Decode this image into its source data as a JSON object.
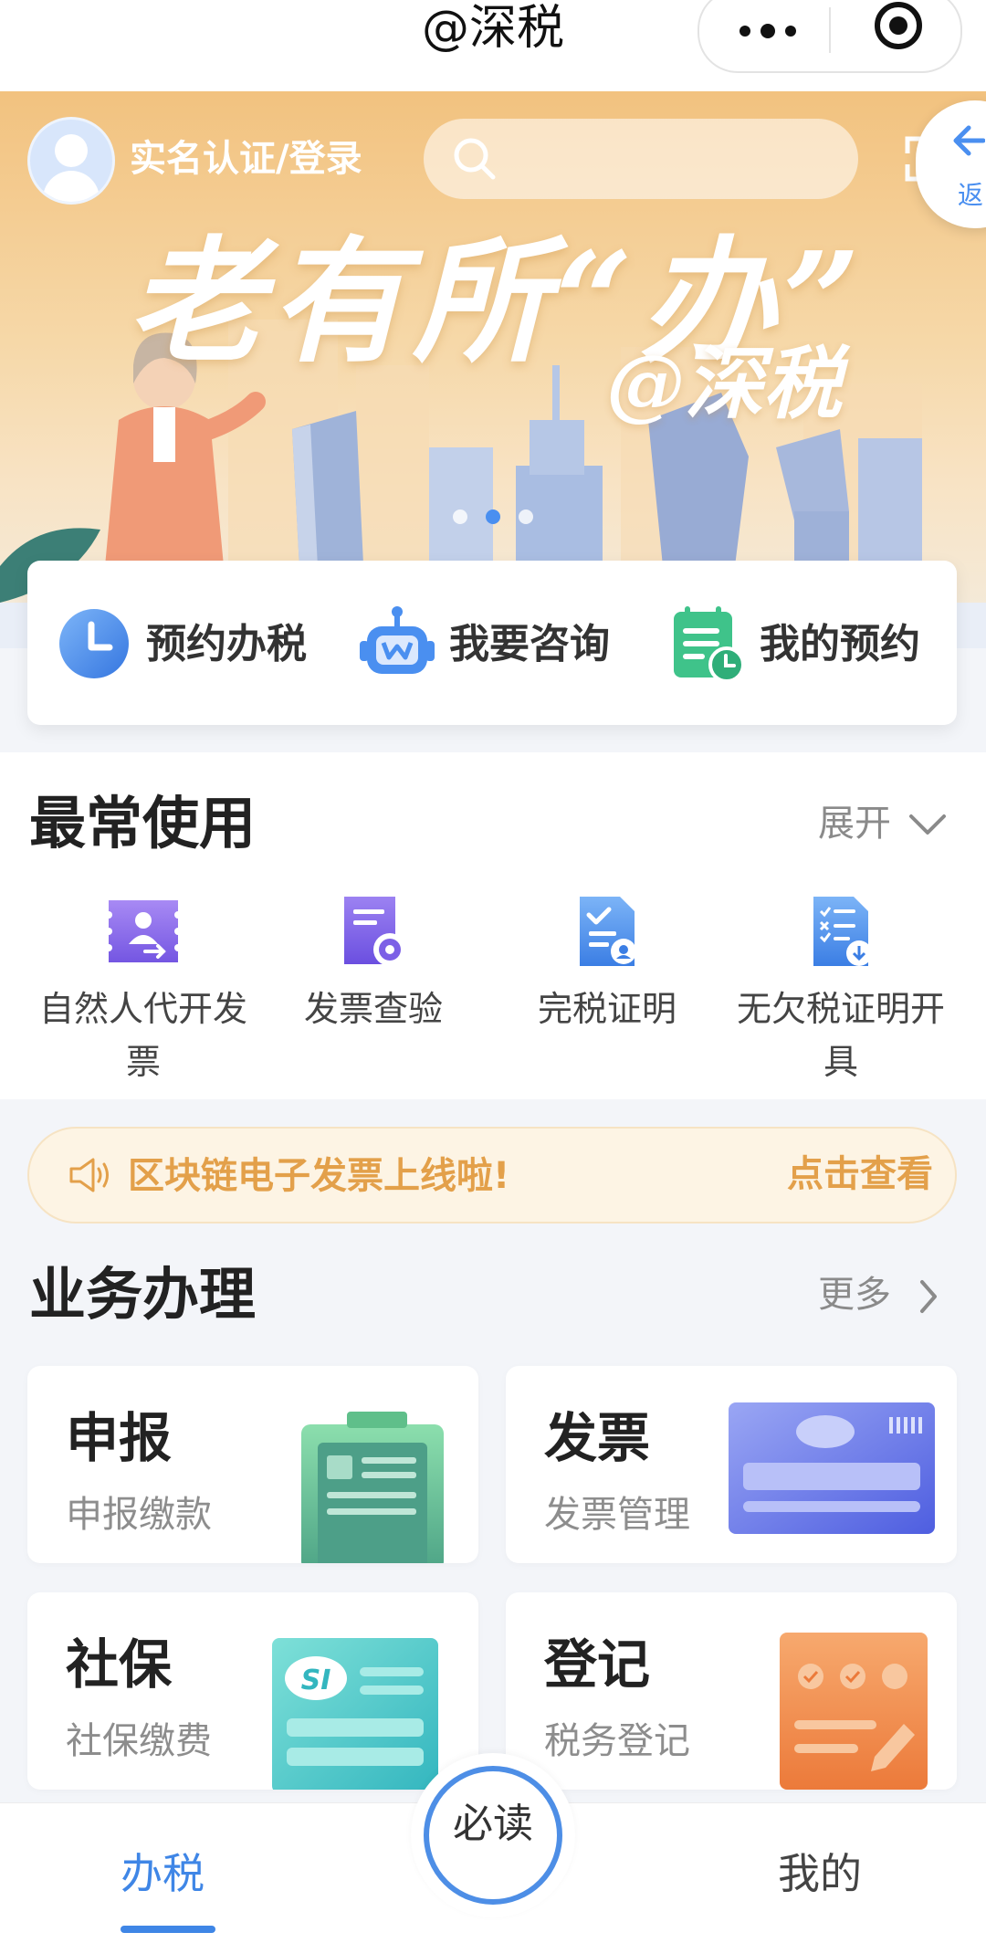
{
  "topbar": {
    "title": "@深税",
    "more_icon": "more-dots-icon",
    "close_icon": "target-close-icon"
  },
  "banner": {
    "login_label": "实名认证/登录",
    "search_placeholder": "",
    "back_label": "返",
    "slogan": "老有所“办”",
    "handle": "@深税",
    "dots": 3,
    "active_dot": 2
  },
  "quick_actions": [
    {
      "label": "预约办税",
      "icon": "clock-icon",
      "color": "#3f86e6"
    },
    {
      "label": "我要咨询",
      "icon": "robot-icon",
      "color": "#4a8ff0"
    },
    {
      "label": "我的预约",
      "icon": "calendar-list-icon",
      "color": "#3fc38a"
    }
  ],
  "most_used": {
    "title": "最常使用",
    "expand_label": "展开",
    "items": [
      {
        "label": "自然人代开发票",
        "icon": "invoice-person-icon"
      },
      {
        "label": "发票查验",
        "icon": "invoice-check-icon"
      },
      {
        "label": "完税证明",
        "icon": "tax-certificate-icon"
      },
      {
        "label": "无欠税证明开具",
        "icon": "no-arrears-certificate-icon"
      }
    ]
  },
  "notice": {
    "message": "区块链电子发票上线啦!",
    "link": "点击查看",
    "icon": "speaker-icon"
  },
  "business": {
    "title": "业务办理",
    "more_label": "更多",
    "cards": [
      {
        "title": "申报",
        "subtitle": "申报缴款",
        "accent": "#5fbf8a"
      },
      {
        "title": "发票",
        "subtitle": "发票管理",
        "accent": "#6a7fe6"
      },
      {
        "title": "社保",
        "subtitle": "社保缴费",
        "accent": "#4cc9c4"
      },
      {
        "title": "登记",
        "subtitle": "税务登记",
        "accent": "#f0894a"
      }
    ]
  },
  "tabbar": {
    "tab1": "办税",
    "center": "必读",
    "tab3": "我的"
  }
}
